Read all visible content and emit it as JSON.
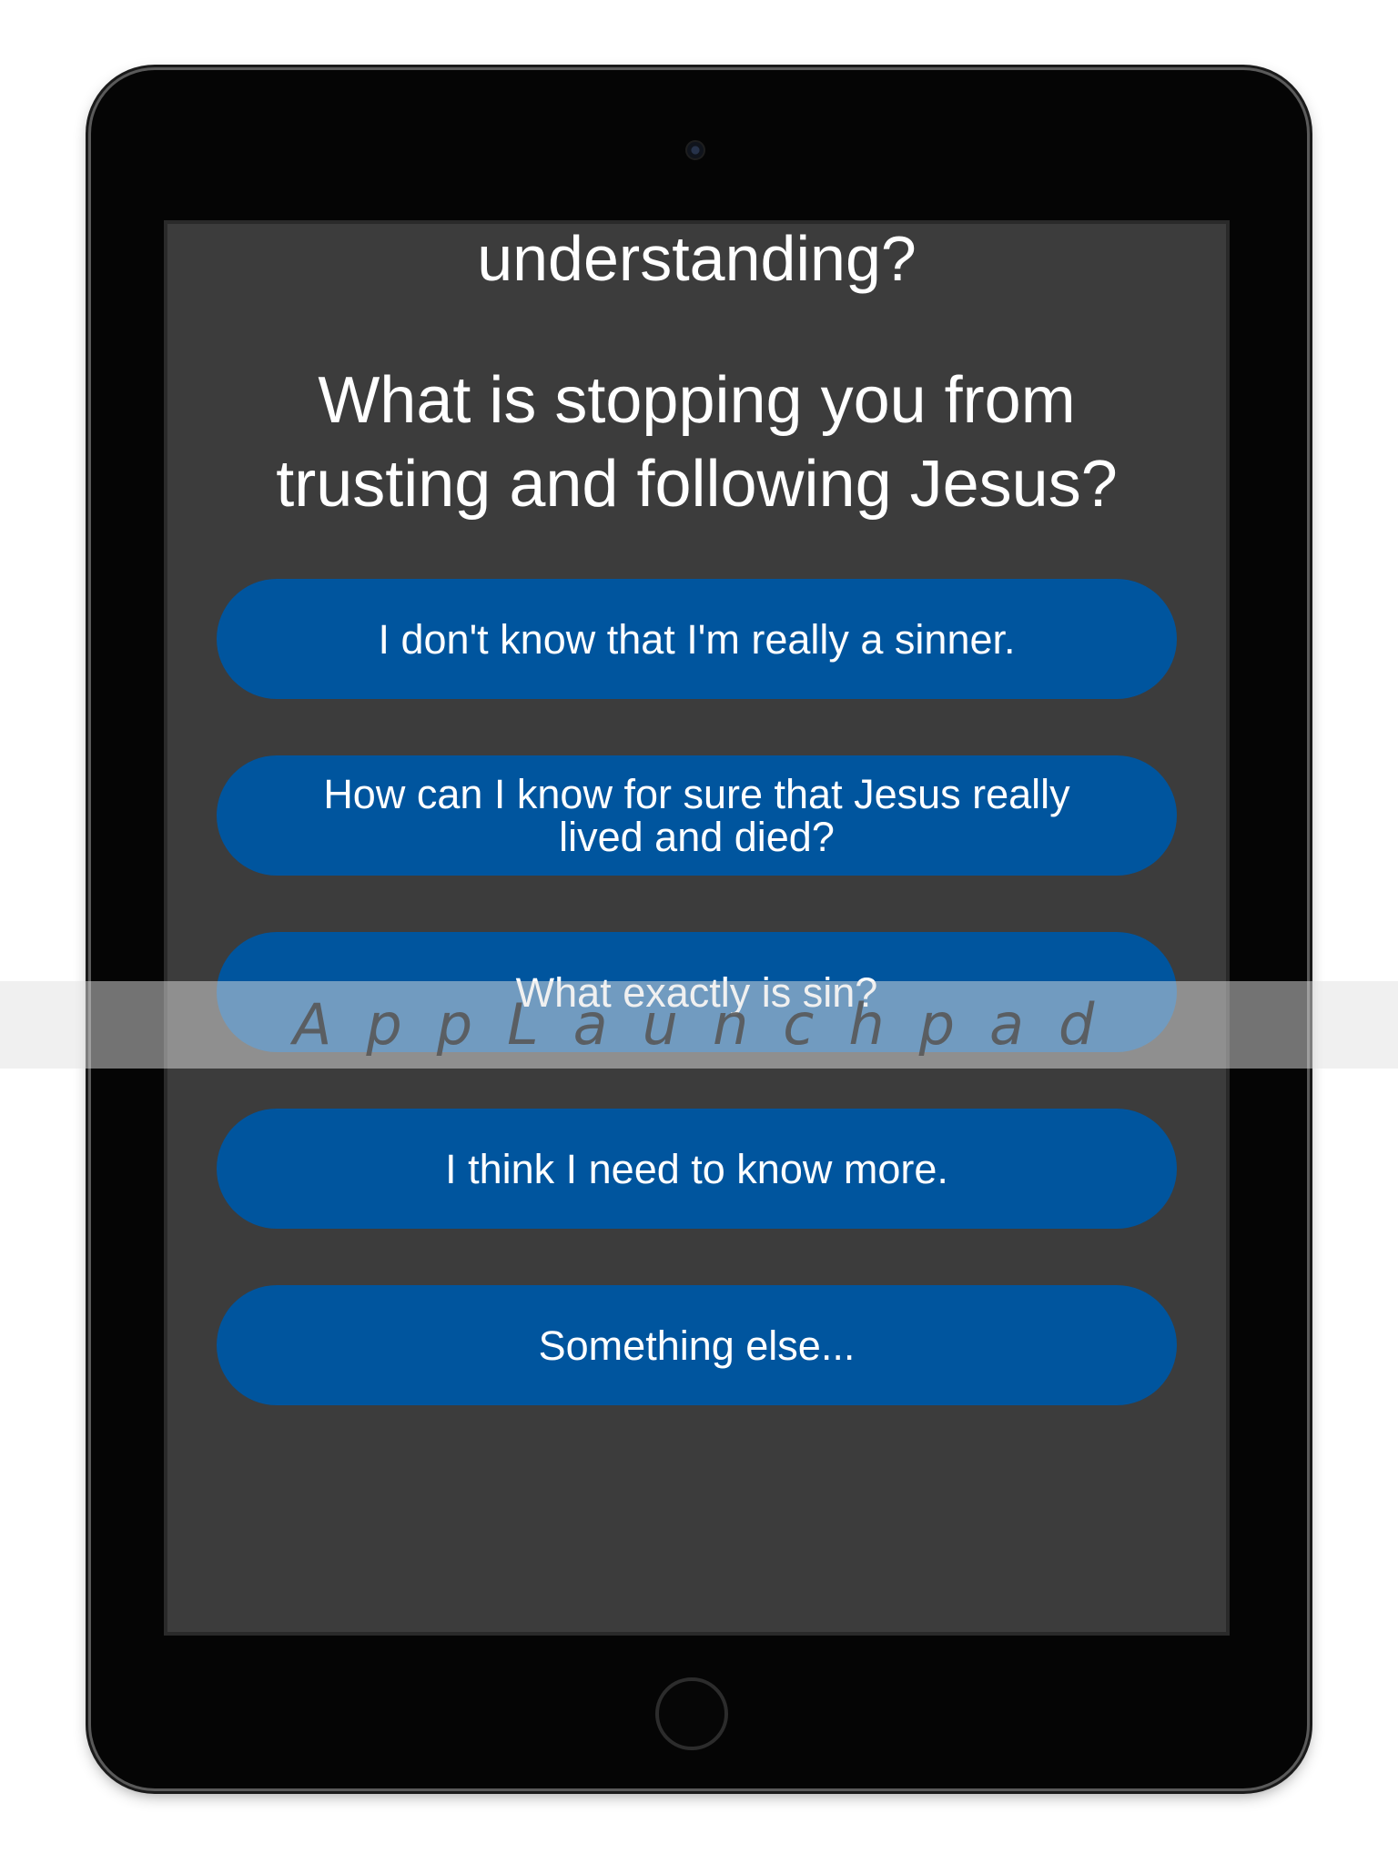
{
  "screen": {
    "previous_question_tail": "understanding?",
    "question": "What is stopping you from trusting and following Jesus?",
    "answers": [
      "I don't know that I'm really a sinner.",
      "How can I know for sure that Jesus really lived and died?",
      "What exactly is sin?",
      "I think I need to know more.",
      "Something else..."
    ]
  },
  "watermark": "AppLaunchpad",
  "colors": {
    "screen_background": "#3c3c3c",
    "button_background": "#00559e",
    "text": "#ffffff",
    "device_bezel": "#050505"
  }
}
